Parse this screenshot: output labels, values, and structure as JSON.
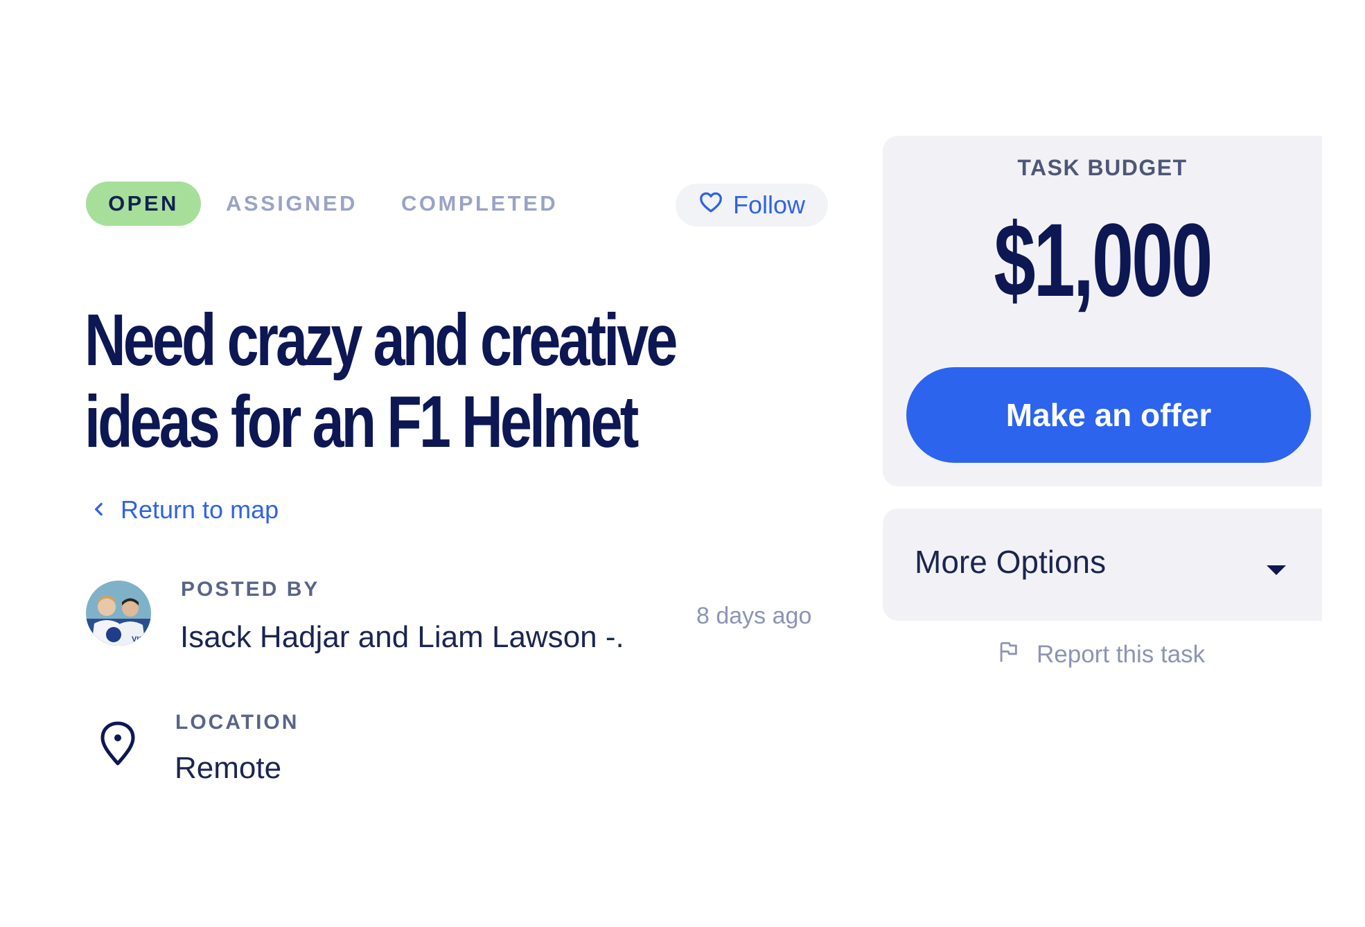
{
  "status_tabs": {
    "open": "OPEN",
    "assigned": "ASSIGNED",
    "completed": "COMPLETED",
    "active": "open"
  },
  "follow": {
    "label": "Follow",
    "icon": "heart-icon"
  },
  "task": {
    "title_line1": "Need crazy and creative",
    "title_line2": "ideas for an F1 Helmet"
  },
  "return_link": {
    "label": "Return to map",
    "icon": "chevron-left-icon"
  },
  "poster": {
    "label": "POSTED BY",
    "name": "Isack Hadjar and Liam Lawson -.",
    "time": "8 days ago"
  },
  "location": {
    "label": "LOCATION",
    "value": "Remote",
    "icon": "map-pin-icon"
  },
  "budget": {
    "label": "TASK BUDGET",
    "amount": "$1,000",
    "offer_label": "Make an offer"
  },
  "more_options": {
    "label": "More Options",
    "icon": "caret-down-icon"
  },
  "report": {
    "label": "Report this task",
    "icon": "flag-icon"
  },
  "colors": {
    "accent_blue": "#2c64ee",
    "navy": "#0d1754",
    "open_green": "#a7df9a",
    "card_bg": "#f2f2f6"
  }
}
